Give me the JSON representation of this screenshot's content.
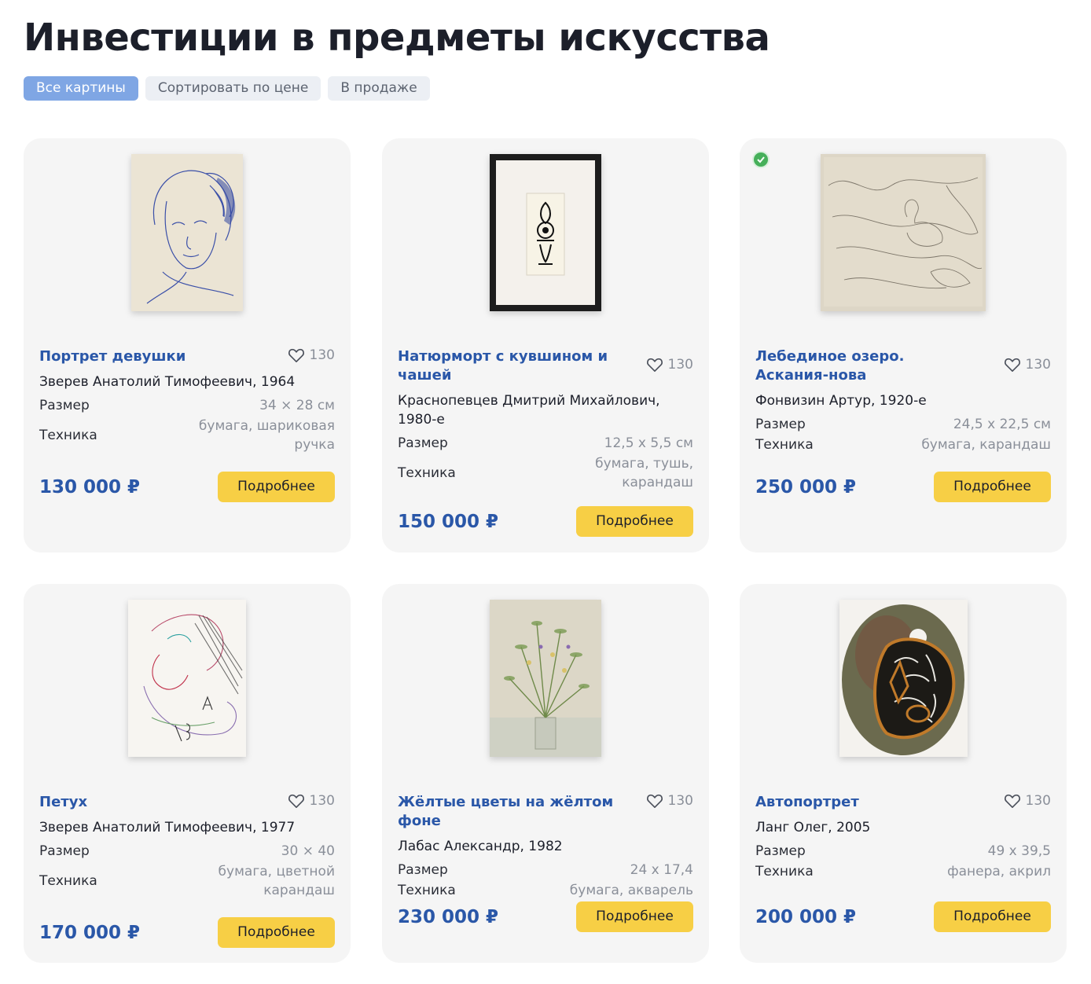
{
  "page": {
    "title": "Инвестиции в предметы искусства"
  },
  "filters": [
    {
      "label": "Все картины",
      "active": true
    },
    {
      "label": "Сортировать по цене",
      "active": false
    },
    {
      "label": "В продаже",
      "active": false
    }
  ],
  "labels": {
    "size": "Размер",
    "technique": "Техника",
    "details_button": "Подробнее"
  },
  "cards": [
    {
      "title": "Портрет девушки",
      "likes": "130",
      "author": "Зверев Анатолий Тимофеевич, 1964",
      "size": "34 × 28 см",
      "technique": "бумага, шариковая ручка",
      "price": "130 000 ₽",
      "verified": false
    },
    {
      "title": "Натюрморт с кувшином и чашей",
      "likes": "130",
      "author": "Краснопевцев Дмитрий Михайлович, 1980-е",
      "size": "12,5 x 5,5 см",
      "technique": "бумага, тушь, карандаш",
      "price": "150 000 ₽",
      "verified": false
    },
    {
      "title": "Лебединое озеро. Аскания-нова",
      "likes": "130",
      "author": "Фонвизин Артур, 1920-е",
      "size": "24,5 x 22,5 см",
      "technique": "бумага, карандаш",
      "price": "250 000 ₽",
      "verified": true
    },
    {
      "title": "Петух",
      "likes": "130",
      "author": "Зверев Анатолий Тимофеевич, 1977",
      "size": "30 × 40",
      "technique": "бумага, цветной карандаш",
      "price": "170 000 ₽",
      "verified": false
    },
    {
      "title": "Жёлтые цветы на жёлтом фоне",
      "likes": "130",
      "author": "Лабас Александр, 1982",
      "size": "24 x 17,4",
      "technique": "бумага, акварель",
      "price": "230 000 ₽",
      "verified": false
    },
    {
      "title": "Автопортрет",
      "likes": "130",
      "author": "Ланг Олег, 2005",
      "size": "49 x 39,5",
      "technique": "фанера, акрил",
      "price": "200 000 ₽",
      "verified": false
    }
  ],
  "colors": {
    "accent": "#2a57a8",
    "button": "#f7cf45",
    "card_bg": "#f5f5f5",
    "active_chip": "#7fa6e4"
  }
}
